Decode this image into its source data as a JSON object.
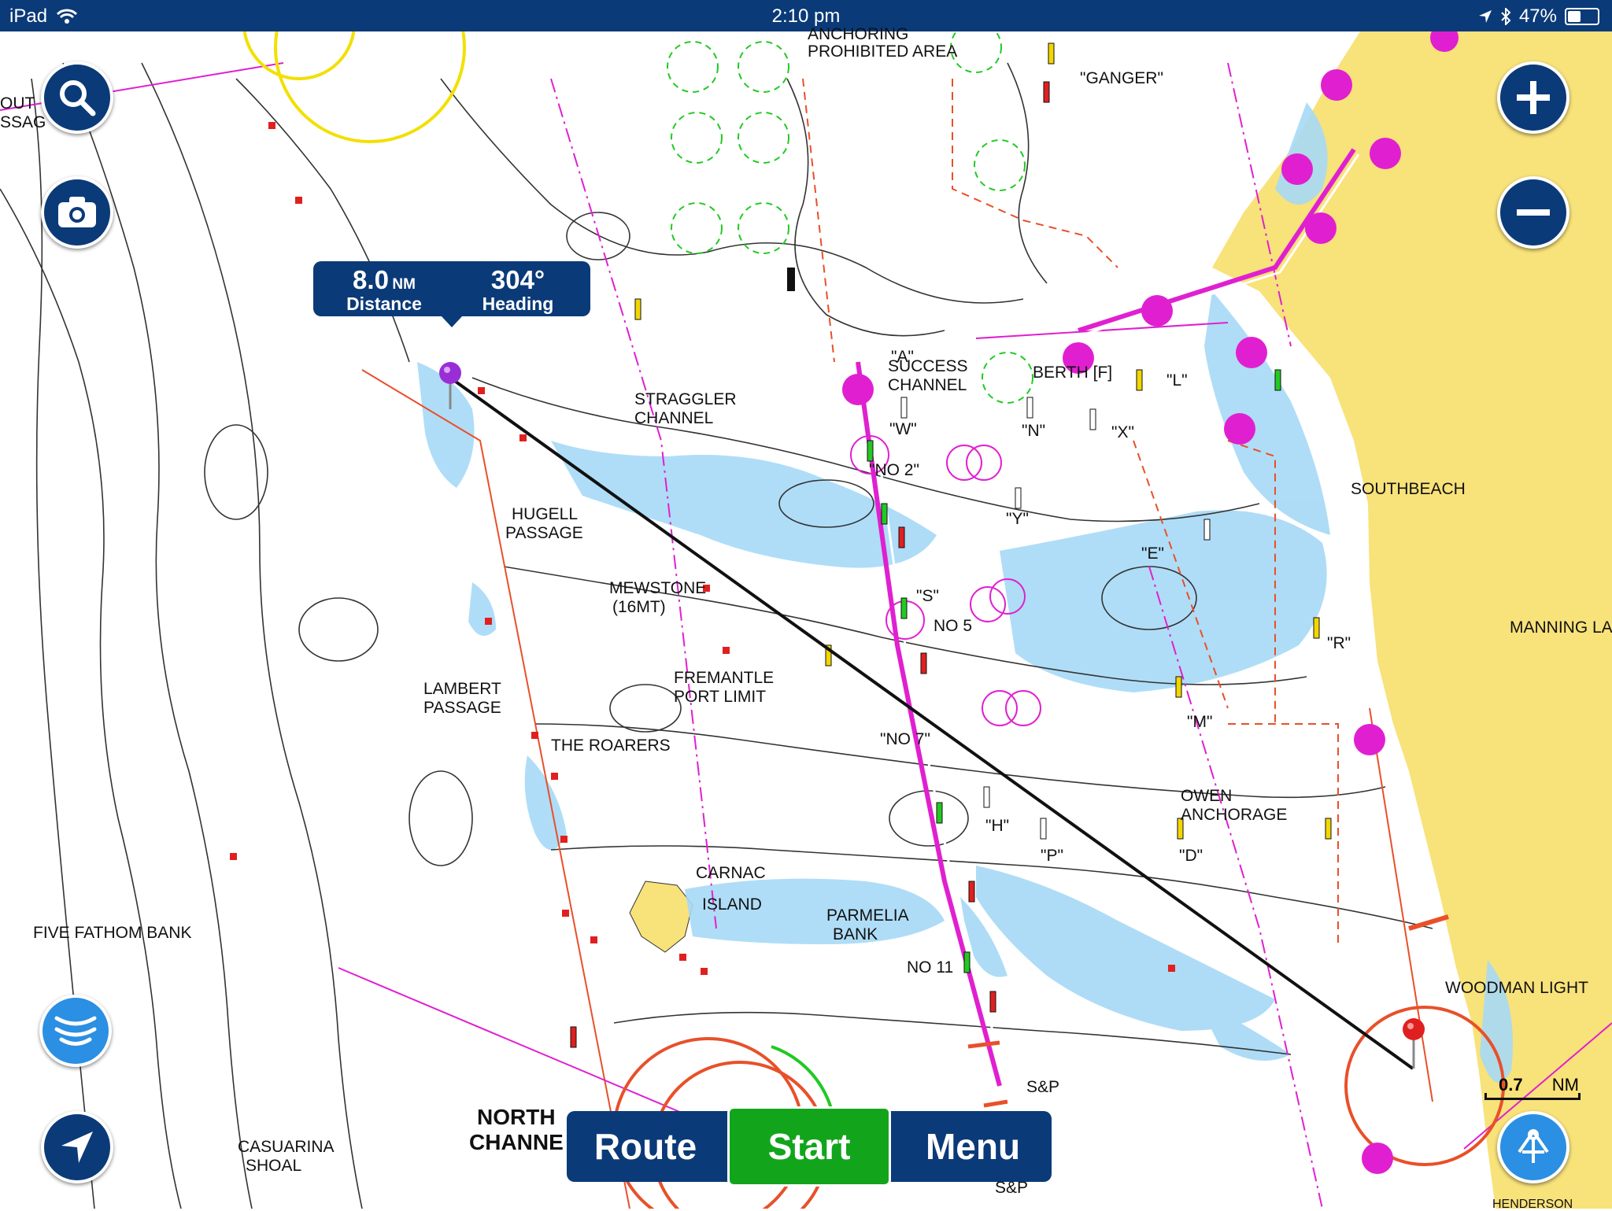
{
  "status_bar": {
    "device": "iPad",
    "time": "2:10 pm",
    "battery": "47%",
    "battery_level": 0.47,
    "icons": [
      "wifi-icon",
      "location-arrow-icon",
      "bluetooth-icon",
      "battery-icon"
    ]
  },
  "colors": {
    "bar": "#0b3a78",
    "start": "#12a51c",
    "land": "#f8e27a",
    "shallow": "#a6d9f6",
    "route_line": "#111111",
    "magenta": "#e020d0"
  },
  "measure": {
    "distance_value": "8.0",
    "distance_unit": "NM",
    "distance_label": "Distance",
    "heading_value": "304°",
    "heading_label": "Heading"
  },
  "route_bar": {
    "route": "Route",
    "start": "Start",
    "menu": "Menu"
  },
  "scale": {
    "value": "0.7",
    "unit": "NM"
  },
  "controls": {
    "search_icon": "search-icon",
    "camera_icon": "camera-icon",
    "sonar_icon": "sonar-icon",
    "navigate_icon": "location-arrow-icon",
    "zoom_in_icon": "plus-icon",
    "zoom_out_icon": "minus-icon",
    "anchor_icon": "anchor-icon"
  },
  "labels": {
    "anchoring": "ANCHORING",
    "prohibited_area": "PROHIBITED AREA",
    "ganger": "\"GANGER\"",
    "out": "OUT",
    "passage_cut": "SSAG",
    "straggler": "STRAGGLER",
    "straggler_channel": "CHANNEL",
    "success": "SUCCESS",
    "success_channel": "CHANNEL",
    "a": "\"A\"",
    "berth": "BERTH [F]",
    "l": "\"L\"",
    "w": "\"W\"",
    "n": "\"N\"",
    "x": "\"X\"",
    "no2": "\"NO 2\"",
    "y": "\"Y\"",
    "southbeach": "SOUTHBEACH",
    "hugell": "HUGELL",
    "hugell_passage": "PASSAGE",
    "mewstone": "MEWSTONE",
    "mewstone_height": "(16MT)",
    "e": "\"E\"",
    "s": "\"S\"",
    "no5": "NO 5",
    "r": "\"R\"",
    "manning": "MANNING LA",
    "lambert": "LAMBERT",
    "lambert_passage": "PASSAGE",
    "fremantle": "FREMANTLE",
    "port_limit": "PORT LIMIT",
    "no7": "\"NO 7\"",
    "m": "\"M\"",
    "the_roarers": "THE ROARERS",
    "owen": "OWEN",
    "anchorage": "ANCHORAGE",
    "h": "\"H\"",
    "p": "\"P\"",
    "d": "\"D\"",
    "carnac": "CARNAC",
    "island": "ISLAND",
    "parmelia": "PARMELIA",
    "bank": "BANK",
    "five_fathom": "FIVE FATHOM BANK",
    "no11": "NO 11",
    "woodman": "WOODMAN LIGHT",
    "sp1": "S&P",
    "sp2": "S&P",
    "north": "NORTH",
    "channel_cut": "CHANNE",
    "casuarina": "CASUARINA",
    "shoal": "SHOAL",
    "henderson_cut": "HENDERSON"
  }
}
